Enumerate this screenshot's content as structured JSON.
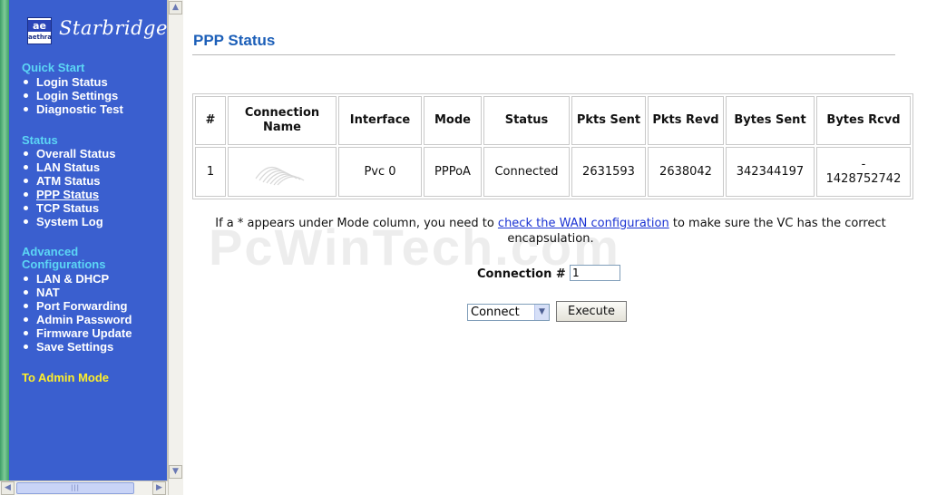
{
  "sidebar": {
    "logo": {
      "mark": "ae",
      "sub": "aethra",
      "brand": "Starbridge"
    },
    "sections": [
      {
        "title": "Quick Start",
        "items": [
          "Login Status",
          "Login Settings",
          "Diagnostic Test"
        ]
      },
      {
        "title": "Status",
        "items": [
          "Overall Status",
          "LAN Status",
          "ATM Status",
          "PPP Status",
          "TCP Status",
          "System Log"
        ]
      },
      {
        "title_line1": "Advanced",
        "title_line2": "Configurations",
        "items": [
          "LAN & DHCP",
          "NAT",
          "Port Forwarding",
          "Admin Password",
          "Firmware Update",
          "Save Settings"
        ]
      }
    ],
    "admin_link": "To Admin Mode"
  },
  "main": {
    "title": "PPP Status",
    "table": {
      "headers": [
        "#",
        "Connection Name",
        "Interface",
        "Mode",
        "Status",
        "Pkts Sent",
        "Pkts Revd",
        "Bytes Sent",
        "Bytes Rcvd"
      ],
      "row": {
        "num": "1",
        "connection_name": "",
        "interface": "Pvc 0",
        "mode": "PPPoA",
        "status": "Connected",
        "pkts_sent": "2631593",
        "pkts_revd": "2638042",
        "bytes_sent": "342344197",
        "bytes_rcvd_line1": "-",
        "bytes_rcvd_line2": "1428752742"
      }
    },
    "message": {
      "before": "If a * appears under Mode column, you need to ",
      "link": "check the WAN configuration",
      "after": " to make sure the VC has the correct encapsulation."
    },
    "connection_label": "Connection #",
    "connection_value": "1",
    "action_select": "Connect",
    "execute_label": "Execute",
    "watermark": "PcWinTech.com"
  }
}
